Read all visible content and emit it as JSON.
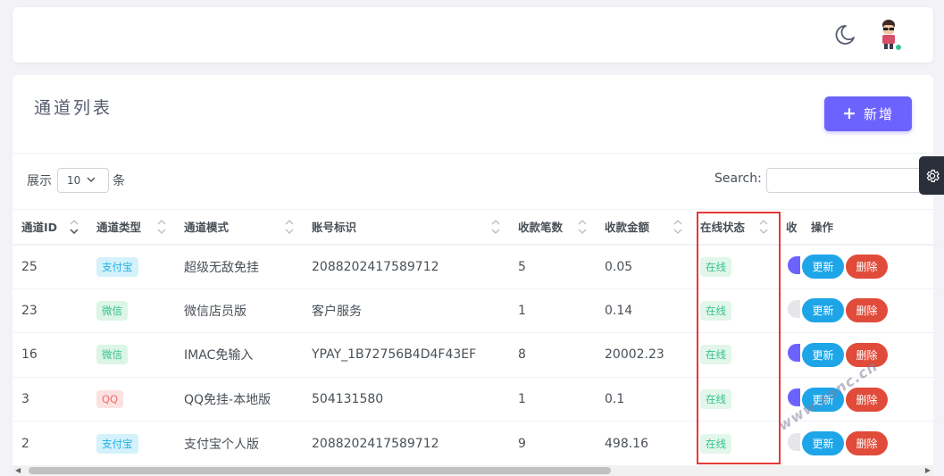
{
  "header": {
    "theme_icon": "moon-icon",
    "avatar_icon": "user-avatar"
  },
  "card": {
    "title": "通道列表",
    "add_button_label": "新增",
    "length_prefix": "展示",
    "length_value": "10",
    "length_suffix": "条",
    "search_label": "Search:",
    "search_value": ""
  },
  "table": {
    "columns": [
      "通道ID",
      "通道类型",
      "通道模式",
      "账号标识",
      "收款笔数",
      "收款金额",
      "在线状态",
      "收",
      "操作"
    ],
    "rows": [
      {
        "id": "25",
        "type": "支付宝",
        "type_kind": "alipay",
        "mode": "超级无敌免挂",
        "account": "2088202417589712",
        "count": "5",
        "amount": "0.05",
        "status": "在线",
        "toggle": "on"
      },
      {
        "id": "23",
        "type": "微信",
        "type_kind": "wechat",
        "mode": "微信店员版",
        "account": "客户服务",
        "count": "1",
        "amount": "0.14",
        "status": "在线",
        "toggle": "off"
      },
      {
        "id": "16",
        "type": "微信",
        "type_kind": "wechat",
        "mode": "IMAC免输入",
        "account": "YPAY_1B72756B4D4F43EF",
        "count": "8",
        "amount": "20002.23",
        "status": "在线",
        "toggle": "on"
      },
      {
        "id": "3",
        "type": "QQ",
        "type_kind": "qq",
        "mode": "QQ免挂-本地版",
        "account": "504131580",
        "count": "1",
        "amount": "0.1",
        "status": "在线",
        "toggle": "on"
      },
      {
        "id": "2",
        "type": "支付宝",
        "type_kind": "alipay",
        "mode": "支付宝个人版",
        "account": "2088202417589712",
        "count": "9",
        "amount": "498.16",
        "status": "在线",
        "toggle": "off"
      }
    ],
    "update_label": "更新",
    "delete_label": "删除"
  },
  "watermark": "www.sanc.cn",
  "colors": {
    "primary": "#6c63ff",
    "update": "#1ea5e8",
    "delete": "#e04b3a",
    "highlight_box": "#e53935"
  }
}
